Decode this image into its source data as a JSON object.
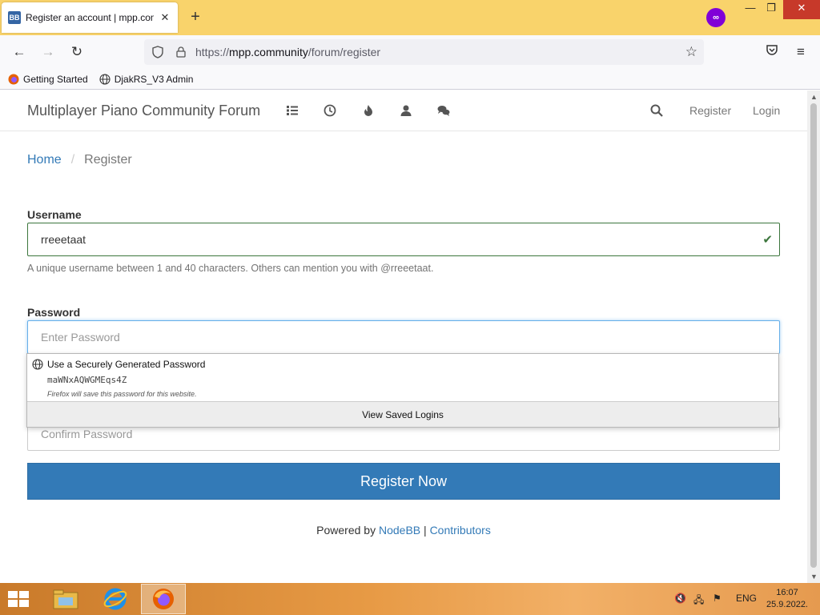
{
  "browser": {
    "tab_title": "Register an account | mpp.community",
    "favicon_text": "BB",
    "url_prefix": "https://",
    "url_host": "mpp.community",
    "url_path": "/forum/register",
    "bookmarks": [
      {
        "label": "Getting Started"
      },
      {
        "label": "DjakRS_V3 Admin"
      }
    ]
  },
  "forum": {
    "brand": "Multiplayer Piano Community Forum",
    "nav_icons": [
      "categories-icon",
      "recent-icon",
      "popular-icon",
      "users-icon",
      "chat-icon"
    ],
    "register_link": "Register",
    "login_link": "Login"
  },
  "breadcrumb": {
    "home": "Home",
    "separator": "/",
    "current": "Register"
  },
  "form": {
    "username_label": "Username",
    "username_value": "rreeetaat",
    "username_help": "A unique username between 1 and 40 characters. Others can mention you with @rreeetaat.",
    "password_label": "Password",
    "password_placeholder": "Enter Password",
    "confirm_placeholder": "Confirm Password",
    "submit_label": "Register Now"
  },
  "autocomplete": {
    "title": "Use a Securely Generated Password",
    "generated_password": "maWNxAQWGMEqs4Z",
    "note": "Firefox will save this password for this website.",
    "view_saved": "View Saved Logins"
  },
  "footer": {
    "prefix": "Powered by",
    "nodebb": "NodeBB",
    "separator": "|",
    "contributors": "Contributors"
  },
  "taskbar": {
    "language": "ENG",
    "time": "16:07",
    "date": "25.9.2022."
  },
  "colors": {
    "tabstrip": "#f9d36b",
    "link": "#337ab7",
    "button": "#337ab7",
    "valid": "#3c763d"
  }
}
